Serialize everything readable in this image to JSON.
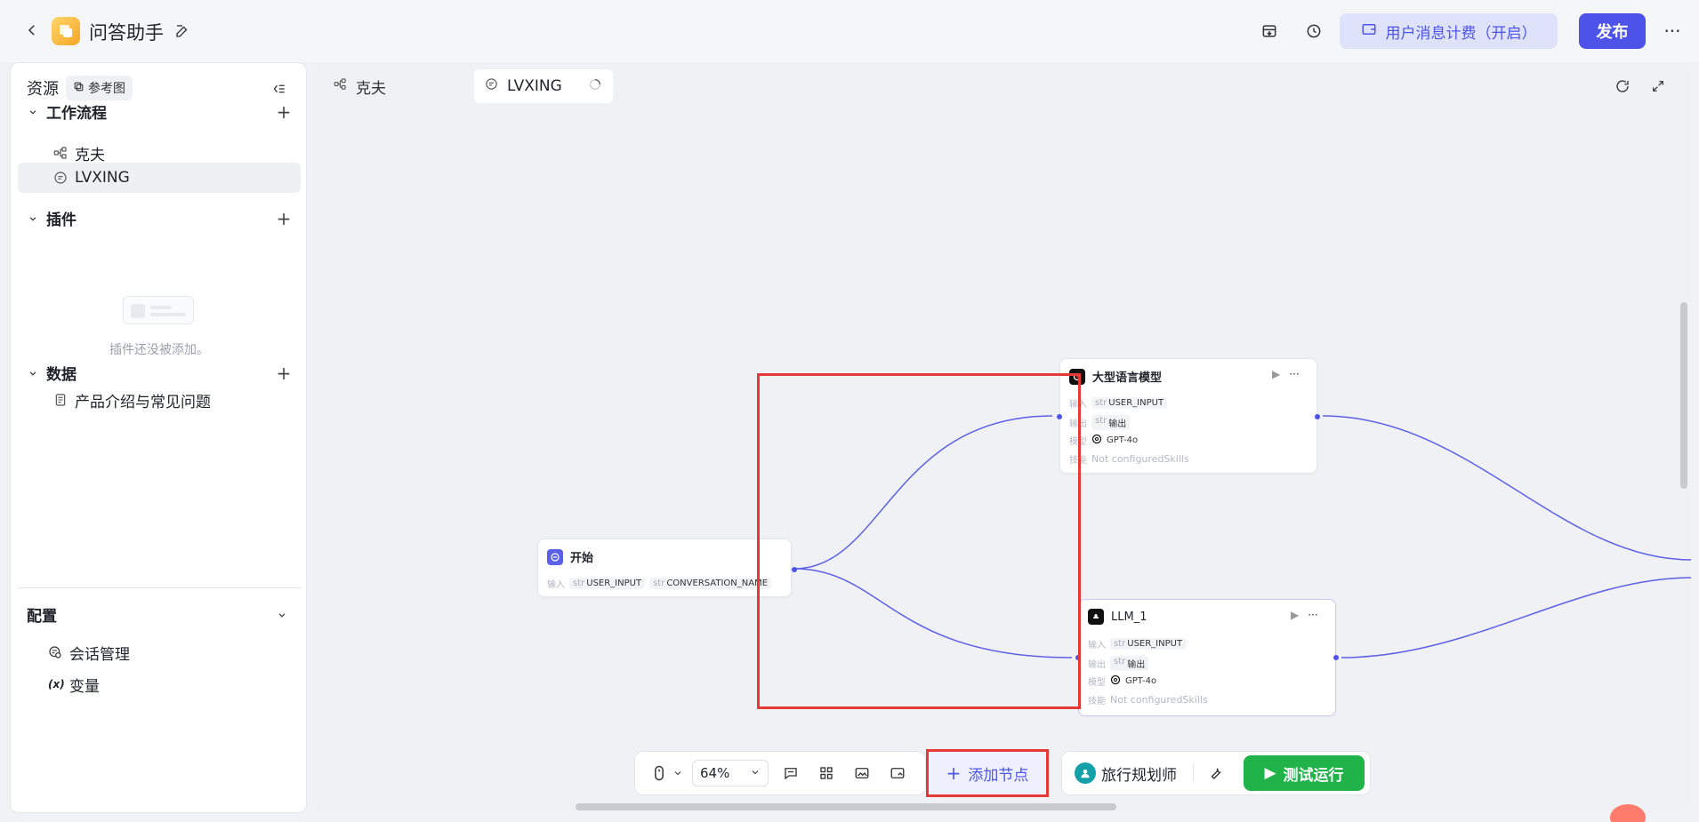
{
  "app": {
    "title": "问答助手"
  },
  "topbar": {
    "billing_label": "用户消息计费（开启）",
    "publish_label": "发布",
    "more": "···"
  },
  "colors": {
    "accent": "#4d53e8",
    "run_green": "#1fb34a",
    "highlight_red": "#e53935"
  },
  "sidebar": {
    "title": "资源",
    "ref_chip": "参考图",
    "sections": {
      "workflow": {
        "label": "工作流程",
        "items": [
          "克夫",
          "LVXING"
        ]
      },
      "plugins": {
        "label": "插件",
        "empty_text": "插件还没被添加。"
      },
      "data": {
        "label": "数据",
        "items": [
          "产品介绍与常见问题"
        ]
      },
      "config": {
        "label": "配置",
        "items": [
          "会话管理",
          "变量"
        ]
      }
    }
  },
  "canvas": {
    "tabs": [
      "克夫",
      "LVXING"
    ],
    "nodes": {
      "start": {
        "title": "开始",
        "input_key": "输入",
        "type_tag": "str",
        "inputs": [
          "USER_INPUT",
          "CONVERSATION_NAME"
        ]
      },
      "llm_main": {
        "title": "大型语言模型",
        "input_key": "输入",
        "output_key": "输出",
        "model_key": "模型",
        "skills_key": "技能",
        "type_tag": "str",
        "input_val": "USER_INPUT",
        "output_val": "输出",
        "model_val": "GPT-4o",
        "skills_val": "Not configuredSkills"
      },
      "llm_1": {
        "title": "LLM_1",
        "input_key": "输入",
        "output_key": "输出",
        "model_key": "模型",
        "skills_key": "技能",
        "type_tag": "str",
        "input_val": "USER_INPUT",
        "output_val": "输出",
        "model_val": "GPT-4o",
        "skills_val": "Not configuredSkills"
      }
    }
  },
  "toolbar": {
    "zoom": "64%",
    "add_node_label": "添加节点",
    "persona_label": "旅行规划师",
    "test_run_label": "测试运行"
  }
}
